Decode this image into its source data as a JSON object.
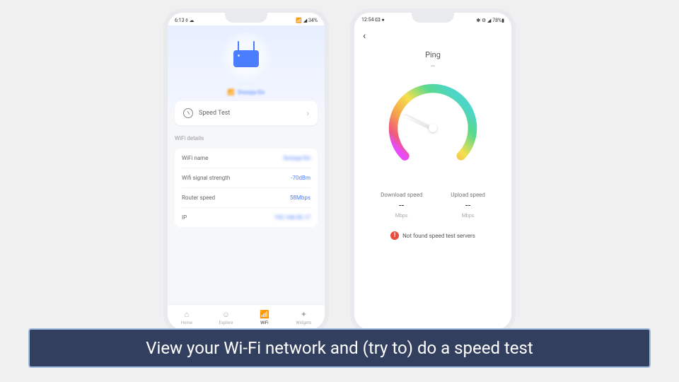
{
  "phone1": {
    "status": {
      "left": "6:13 ◊ ☁",
      "right": "📶 ◢ 34%"
    },
    "ssid": "Snoopy-Do",
    "speed_test_label": "Speed Test",
    "section_title": "WiFi details",
    "details": [
      {
        "label": "WiFi name",
        "value": "Snoopy-Do",
        "blur": true
      },
      {
        "label": "Wifi signal strength",
        "value": "-70dBm",
        "blur": false
      },
      {
        "label": "Router speed",
        "value": "58Mbps",
        "blur": false
      },
      {
        "label": "IP",
        "value": "192.168.00.17",
        "blur": true
      }
    ],
    "nav": [
      {
        "label": "Home",
        "active": false
      },
      {
        "label": "Explore",
        "active": false
      },
      {
        "label": "WiFi",
        "active": true
      },
      {
        "label": "Widgets",
        "active": false
      }
    ]
  },
  "phone2": {
    "status": {
      "left": "12:54 🖾 ●",
      "right": "✽ ⚙ ◢ 78%▮"
    },
    "ping_label": "Ping",
    "ping_value": "--",
    "download": {
      "label": "Download speed",
      "value": "--",
      "unit": "Mbps"
    },
    "upload": {
      "label": "Upload speed",
      "value": "--",
      "unit": "Mbps"
    },
    "error": "Not found speed test servers"
  },
  "caption": "View your Wi-Fi network and (try to) do a speed test"
}
